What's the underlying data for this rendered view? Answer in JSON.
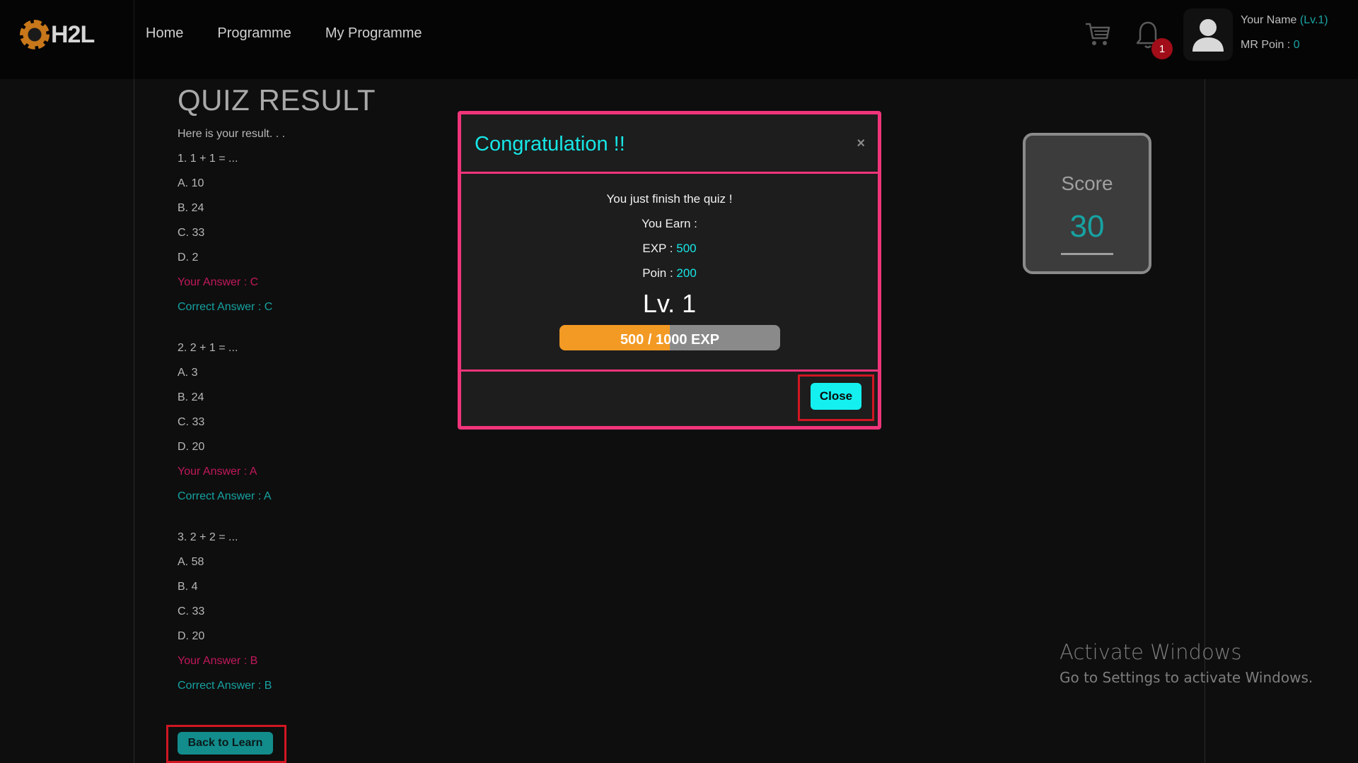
{
  "header": {
    "logo_text": "H2L",
    "nav": [
      "Home",
      "Programme",
      "My Programme"
    ],
    "notification_count": "1",
    "user_name": "Your Name",
    "user_level": "(Lv.1)",
    "poin_label": "MR Poin : ",
    "poin_value": "0"
  },
  "quiz": {
    "title": "QUIZ RESULT",
    "subtitle": "Here is your result. . .",
    "questions": [
      {
        "question": "1. 1 + 1 = ...",
        "options": [
          "A. 10",
          "B. 24",
          "C. 33",
          "D. 2"
        ],
        "your_answer": "Your Answer : C",
        "correct_answer": "Correct Answer : C"
      },
      {
        "question": "2. 2 + 1 = ...",
        "options": [
          "A. 3",
          "B. 24",
          "C. 33",
          "D. 20"
        ],
        "your_answer": "Your Answer : A",
        "correct_answer": "Correct Answer : A"
      },
      {
        "question": "3. 2 + 2 = ...",
        "options": [
          "A. 58",
          "B. 4",
          "C. 33",
          "D. 20"
        ],
        "your_answer": "Your Answer : B",
        "correct_answer": "Correct Answer : B"
      }
    ],
    "back_label": "Back to Learn"
  },
  "score": {
    "label": "Score",
    "value": "30"
  },
  "modal": {
    "title": "Congratulation !!",
    "close_x": "×",
    "finish_text": "You just finish the quiz !",
    "earn_text": "You Earn :",
    "exp_label": "EXP : ",
    "exp_value": "500",
    "poin_label": "Poin : ",
    "poin_value": "200",
    "level_text": "Lv. 1",
    "exp_progress_text": "500 / 1000 EXP",
    "exp_progress_fraction": 0.5,
    "close_label": "Close"
  },
  "watermark": {
    "title": "Activate Windows",
    "subtitle": "Go to Settings to activate Windows."
  },
  "colors": {
    "accent_cyan": "#17e6e6",
    "teal": "#17a2a2",
    "answer_red": "#c2185b",
    "modal_border": "#f0347a",
    "exp_fill": "#f39a24",
    "highlight_red": "#d01622"
  }
}
